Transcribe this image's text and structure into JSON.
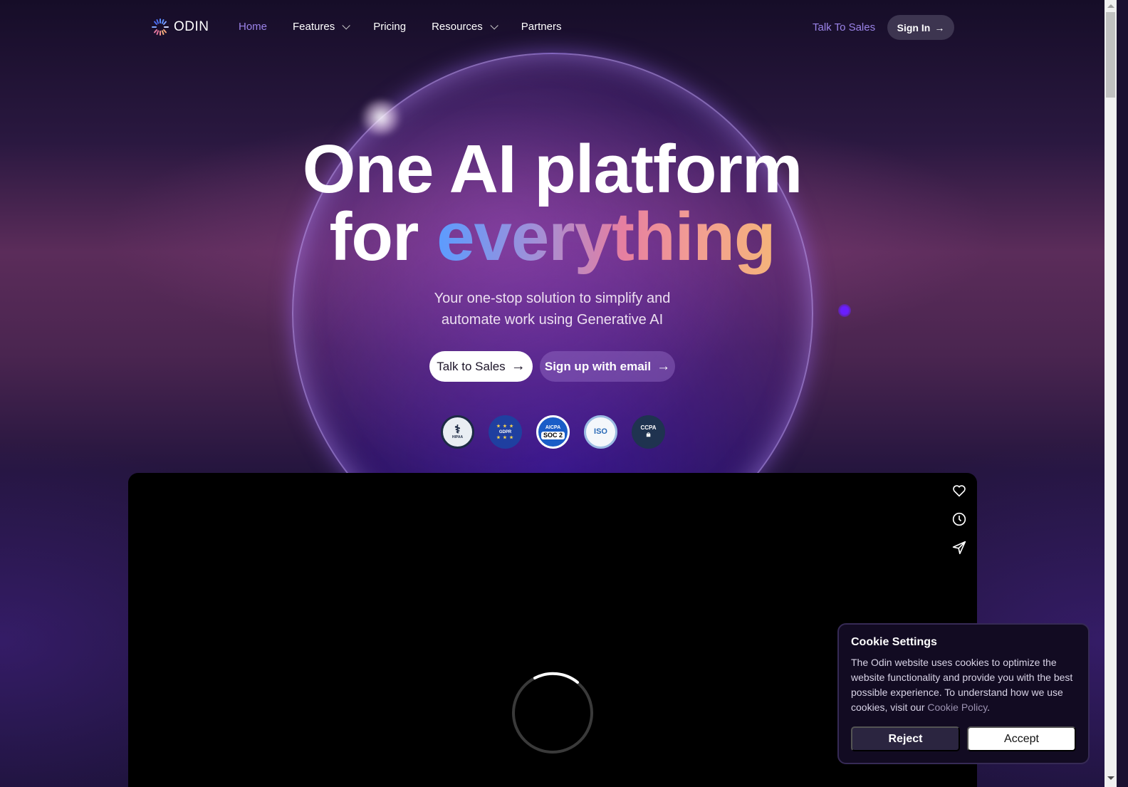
{
  "nav": {
    "logo_text": "ODIN",
    "links": [
      {
        "label": "Home",
        "active": true,
        "dropdown": false
      },
      {
        "label": "Features",
        "active": false,
        "dropdown": true
      },
      {
        "label": "Pricing",
        "active": false,
        "dropdown": false
      },
      {
        "label": "Resources",
        "active": false,
        "dropdown": true
      },
      {
        "label": "Partners",
        "active": false,
        "dropdown": false
      }
    ],
    "talk_to_sales": "Talk To Sales",
    "sign_in": "Sign In",
    "arrow": "→"
  },
  "hero": {
    "title_line1": "One AI platform",
    "title_line2_plain": "for ",
    "title_line2_gradient": "everything",
    "subtitle_line1": "Your one-stop solution to simplify and",
    "subtitle_line2": "automate work using Generative AI",
    "cta_sales": "Talk to Sales",
    "cta_signup": "Sign up with email",
    "arrow": "→"
  },
  "badges": [
    {
      "name": "HIPAA",
      "label": "HIPAA"
    },
    {
      "name": "GDPR",
      "label": "GDPR"
    },
    {
      "name": "AICPA SOC 2",
      "label_top": "AICPA",
      "label_bottom": "SOC 2"
    },
    {
      "name": "ISO 27001",
      "label": "ISO"
    },
    {
      "name": "CCPA",
      "label": "CCPA"
    }
  ],
  "video": {
    "actions": [
      "heart-icon",
      "clock-icon",
      "send-icon"
    ]
  },
  "cookie": {
    "title": "Cookie Settings",
    "body": "The Odin website uses cookies to optimize the website functionality and provide you with the best possible experience. To understand how we use cookies, visit our ",
    "policy_link": "Cookie Policy",
    "period": ".",
    "reject": "Reject",
    "accept": "Accept"
  },
  "colors": {
    "accent_purple": "#9b83e8",
    "gradient": [
      "#5b9cff",
      "#a38fd6",
      "#e67fa0",
      "#f4b47a"
    ]
  }
}
